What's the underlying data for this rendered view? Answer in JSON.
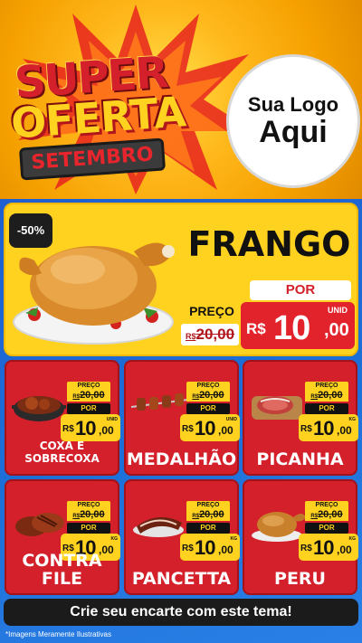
{
  "header": {
    "title_line1": "SUPER",
    "title_line2": "OFERTA",
    "month": "SETEMBRO",
    "logo_line1": "Sua Logo",
    "logo_line2": "Aqui"
  },
  "featured": {
    "discount": "-50%",
    "name": "FRANGO",
    "price_label": "PREÇO",
    "old_currency": "R$",
    "old_price": "20,00",
    "por_label": "POR",
    "new_currency": "R$",
    "new_price_int": "10",
    "new_price_dec": ",00",
    "unit": "UNID"
  },
  "products": [
    {
      "name": "COXA E SOBRECOXA",
      "price_label": "PREÇO",
      "old_currency": "R$",
      "old_price": "20,00",
      "por_label": "POR",
      "currency": "R$",
      "price_int": "10",
      "price_dec": ",00",
      "unit": "UNID",
      "icon": "chicken-pot-icon"
    },
    {
      "name": "MEDALHÃO",
      "price_label": "PREÇO",
      "old_currency": "R$",
      "old_price": "20,00",
      "por_label": "POR",
      "currency": "R$",
      "price_int": "10",
      "price_dec": ",00",
      "unit": "UNID",
      "icon": "skewers-icon"
    },
    {
      "name": "PICANHA",
      "price_label": "PREÇO",
      "old_currency": "R$",
      "old_price": "20,00",
      "por_label": "POR",
      "currency": "R$",
      "price_int": "10",
      "price_dec": ",00",
      "unit": "KG",
      "icon": "steak-board-icon"
    },
    {
      "name": "CONTRA FILE",
      "price_label": "PREÇO",
      "old_currency": "R$",
      "old_price": "20,00",
      "por_label": "POR",
      "currency": "R$",
      "price_int": "10",
      "price_dec": ",00",
      "unit": "KG",
      "icon": "steaks-icon"
    },
    {
      "name": "PANCETTA",
      "price_label": "PREÇO",
      "old_currency": "R$",
      "old_price": "20,00",
      "por_label": "POR",
      "currency": "R$",
      "price_int": "10",
      "price_dec": ",00",
      "unit": "KG",
      "icon": "pancetta-icon"
    },
    {
      "name": "PERU",
      "price_label": "PREÇO",
      "old_currency": "R$",
      "old_price": "20,00",
      "por_label": "POR",
      "currency": "R$",
      "price_int": "10",
      "price_dec": ",00",
      "unit": "KG",
      "icon": "roast-turkey-icon"
    }
  ],
  "cta_label": "Crie seu encarte com este tema!",
  "footnote": "*Imagens Meramente Ilustrativas",
  "colors": {
    "brand_red": "#d3202a",
    "brand_yellow": "#ffd21f",
    "background_blue": "#1d6fd8"
  }
}
